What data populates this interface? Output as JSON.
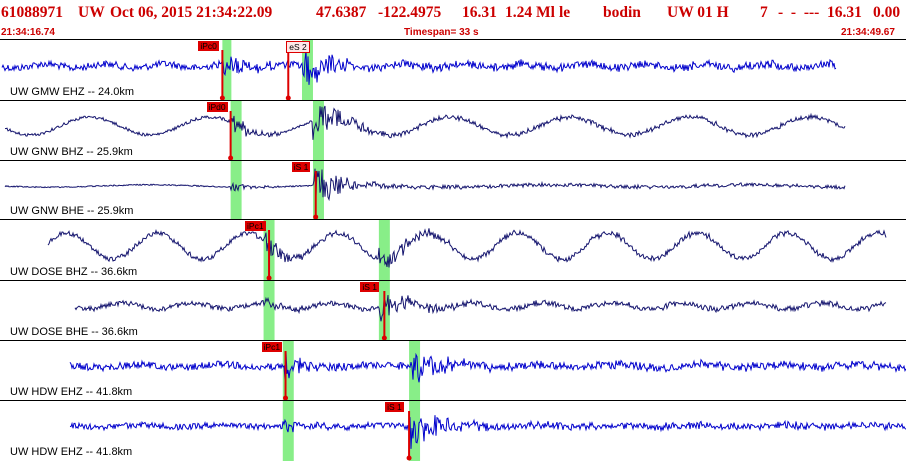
{
  "header": {
    "event_id": "61088971",
    "network": "UW",
    "datetime": "Oct 06, 2015 21:34:22.09",
    "lat": "47.6387",
    "lon": "-122.4975",
    "depth": "16.31",
    "magnitude": "1.24 Ml",
    "type": "le",
    "author": "bodin",
    "source": "UW 01 H",
    "quality": "7",
    "dashes": "-  -  ---",
    "depth2": "16.31",
    "rms": "0.00"
  },
  "subheader": {
    "start_time": "21:34:16.74",
    "timespan": "Timespan=  33 s",
    "end_time": "21:34:49.67"
  },
  "colors": {
    "header_text": "#cc0000",
    "trace_blue": "#0000cc",
    "trace_navy": "#14146e",
    "pick_red": "#dd0000",
    "pick_hollow_fill": "#ffe8e8",
    "window_green": "#88ee88"
  },
  "panels": [
    {
      "label": "UW GMW EHZ -- 24.0km",
      "trace_color": "blue",
      "picks": [
        {
          "label": "iPc0",
          "style": "filled",
          "t": 8.1
        },
        {
          "label": "eS 2",
          "style": "hollow",
          "t": 10.5
        }
      ],
      "windows": [
        {
          "t0": 8.1,
          "t1": 8.4
        },
        {
          "t0": 11.0,
          "t1": 11.4
        }
      ]
    },
    {
      "label": "UW GNW BHZ -- 25.9km",
      "trace_color": "navy",
      "picks": [
        {
          "label": "iPd0",
          "style": "filled",
          "t": 8.4
        }
      ],
      "windows": [
        {
          "t0": 8.4,
          "t1": 8.8
        },
        {
          "t0": 11.4,
          "t1": 11.8
        }
      ]
    },
    {
      "label": "UW GNW BHE -- 25.9km",
      "trace_color": "navy",
      "picks": [
        {
          "label": "iS 1",
          "style": "filled",
          "t": 11.5
        }
      ],
      "windows": [
        {
          "t0": 8.4,
          "t1": 8.8
        },
        {
          "t0": 11.4,
          "t1": 11.8
        }
      ]
    },
    {
      "label": "UW DOSE BHZ -- 36.6km",
      "trace_color": "navy",
      "picks": [
        {
          "label": "iPc1",
          "style": "filled",
          "t": 9.8
        }
      ],
      "windows": [
        {
          "t0": 9.6,
          "t1": 10.0
        },
        {
          "t0": 13.8,
          "t1": 14.2
        }
      ]
    },
    {
      "label": "UW DOSE BHE -- 36.6km",
      "trace_color": "navy",
      "picks": [
        {
          "label": "iS 1",
          "style": "filled",
          "t": 14.0
        }
      ],
      "windows": [
        {
          "t0": 9.6,
          "t1": 10.0
        },
        {
          "t0": 13.8,
          "t1": 14.2
        }
      ]
    },
    {
      "label": "UW HDW EHZ -- 41.8km",
      "trace_color": "blue",
      "picks": [
        {
          "label": "iPc1",
          "style": "filled",
          "t": 10.4
        }
      ],
      "windows": [
        {
          "t0": 10.3,
          "t1": 10.7
        },
        {
          "t0": 14.9,
          "t1": 15.3
        }
      ]
    },
    {
      "label": "UW HDW EHZ -- 41.8km",
      "trace_color": "blue",
      "picks": [
        {
          "label": "iS 1",
          "style": "filled",
          "t": 14.9
        }
      ],
      "windows": [
        {
          "t0": 10.3,
          "t1": 10.7
        },
        {
          "t0": 14.9,
          "t1": 15.3
        }
      ]
    }
  ]
}
